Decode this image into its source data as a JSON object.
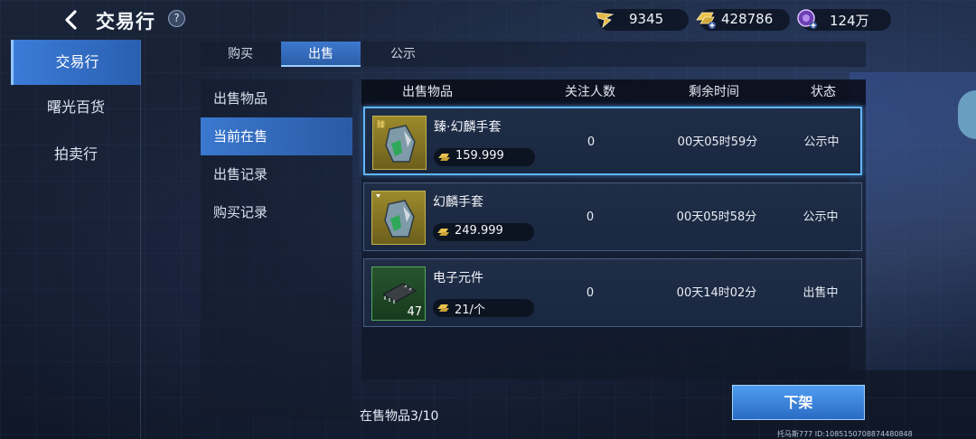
{
  "header": {
    "title": "交易行",
    "help": "?",
    "currencies": [
      {
        "icon": "wing-token-icon",
        "value": "9345"
      },
      {
        "icon": "gold-bar-add-icon",
        "value": "428786"
      },
      {
        "icon": "purple-gem-add-icon",
        "value": "124万"
      }
    ]
  },
  "leftnav": {
    "items": [
      {
        "label": "交易行",
        "active": true
      },
      {
        "label": "曙光百货",
        "active": false
      },
      {
        "label": "拍卖行",
        "active": false
      }
    ]
  },
  "tabs": [
    {
      "label": "购买",
      "active": false
    },
    {
      "label": "出售",
      "active": true
    },
    {
      "label": "公示",
      "active": false
    }
  ],
  "submenu": [
    {
      "label": "出售物品",
      "active": false
    },
    {
      "label": "当前在售",
      "active": true
    },
    {
      "label": "出售记录",
      "active": false
    },
    {
      "label": "购买记录",
      "active": false
    }
  ],
  "table": {
    "columns": [
      "出售物品",
      "关注人数",
      "剩余时间",
      "状态"
    ],
    "rows": [
      {
        "name": "臻·幻麟手套",
        "price": "159.999",
        "watchers": "0",
        "time_left": "00天05时59分",
        "status": "公示中",
        "quality_badge": "臻",
        "icon": "gauntlet-icon"
      },
      {
        "name": "幻麟手套",
        "price": "249.999",
        "watchers": "0",
        "time_left": "00天05时58分",
        "status": "公示中",
        "quality_badge": "",
        "icon": "gauntlet-icon"
      },
      {
        "name": "电子元件",
        "price": "21/个",
        "watchers": "0",
        "time_left": "00天14时02分",
        "status": "出售中",
        "count": "47",
        "icon": "chip-icon"
      }
    ]
  },
  "footer": {
    "on_sale": "在售物品3/10",
    "unlist_button": "下架",
    "player_id": "托马斯777  ID:1085150708874480848"
  },
  "colors": {
    "accent_blue": "#3b7cd8",
    "gold_frame": "#c3b24e",
    "green_frame": "#52a85c",
    "selected_border": "#5fb6ff"
  }
}
